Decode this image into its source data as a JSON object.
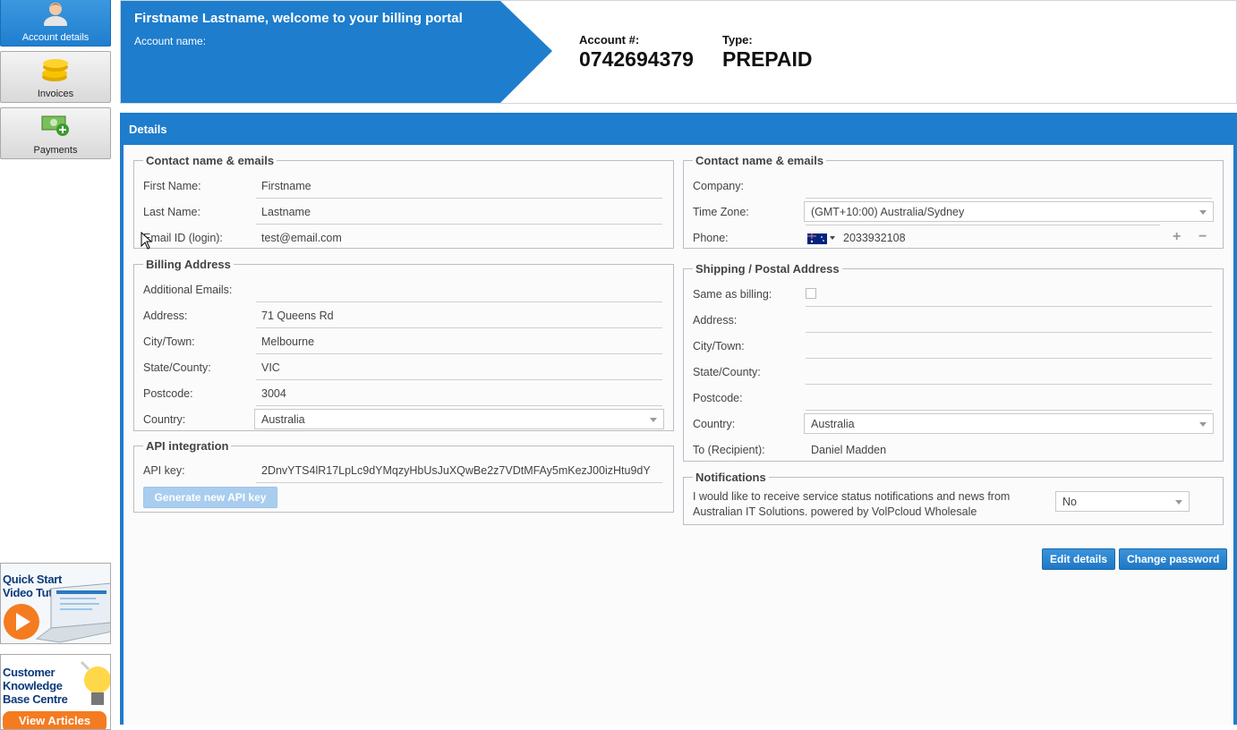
{
  "sidebar": {
    "items": [
      {
        "label": "Account details",
        "icon": "user-icon",
        "active": true
      },
      {
        "label": "Invoices",
        "icon": "coins-icon",
        "active": false
      },
      {
        "label": "Payments",
        "icon": "money-add-icon",
        "active": false
      }
    ],
    "promos": [
      {
        "title_lines": [
          "Quick Start",
          "Video Tutorial"
        ],
        "icon": "play-icon"
      },
      {
        "title_lines": [
          "Customer",
          "Knowledge",
          "Base Centre"
        ],
        "button": "View Articles",
        "icon": "lightbulb-icon"
      }
    ]
  },
  "header": {
    "title": "Firstname Lastname, welcome to your billing portal",
    "account_name_label": "Account name:",
    "account_number_label": "Account #:",
    "account_number": "0742694379",
    "type_label": "Type:",
    "type_value": "PREPAID"
  },
  "details": {
    "title": "Details",
    "contact_left": {
      "legend": "Contact name & emails",
      "first_name_label": "First Name:",
      "first_name": "Firstname",
      "last_name_label": "Last Name:",
      "last_name": "Lastname",
      "email_label": "Email ID (login):",
      "email": "test@email.com"
    },
    "contact_right": {
      "legend": "Contact name & emails",
      "company_label": "Company:",
      "company": "",
      "timezone_label": "Time Zone:",
      "timezone": "(GMT+10:00) Australia/Sydney",
      "phone_label": "Phone:",
      "phone": "2033932108",
      "phone_add": "+",
      "phone_remove": "−"
    },
    "billing": {
      "legend": "Billing Address",
      "additional_emails_label": "Additional Emails:",
      "additional_emails": "",
      "address_label": "Address:",
      "address": "71 Queens Rd",
      "city_label": "City/Town:",
      "city": "Melbourne",
      "state_label": "State/County:",
      "state": "VIC",
      "postcode_label": "Postcode:",
      "postcode": "3004",
      "country_label": "Country:",
      "country": "Australia"
    },
    "shipping": {
      "legend": "Shipping / Postal Address",
      "same_label": "Same as billing:",
      "same_checked": false,
      "address_label": "Address:",
      "city_label": "City/Town:",
      "state_label": "State/County:",
      "postcode_label": "Postcode:",
      "country_label": "Country:",
      "country": "Australia",
      "recipient_label": "To (Recipient):",
      "recipient": "Daniel Madden"
    },
    "api": {
      "legend": "API integration",
      "key_label": "API key:",
      "key": "2DnvYTS4lR17LpLc9dYMqzyHbUsJuXQwBe2z7VDtMFAy5mKezJ00izHtu9dY",
      "generate_label": "Generate new API key"
    },
    "notifications": {
      "legend": "Notifications",
      "text_line1": "I would like to receive service status notifications and news from",
      "text_line2": "Australian IT Solutions. powered by VolPcloud Wholesale",
      "value": "No"
    },
    "edit_label": "Edit details",
    "change_password_label": "Change password"
  },
  "colors": {
    "primary_blue": "#1e7dcc",
    "accent_orange": "#f47b20"
  }
}
